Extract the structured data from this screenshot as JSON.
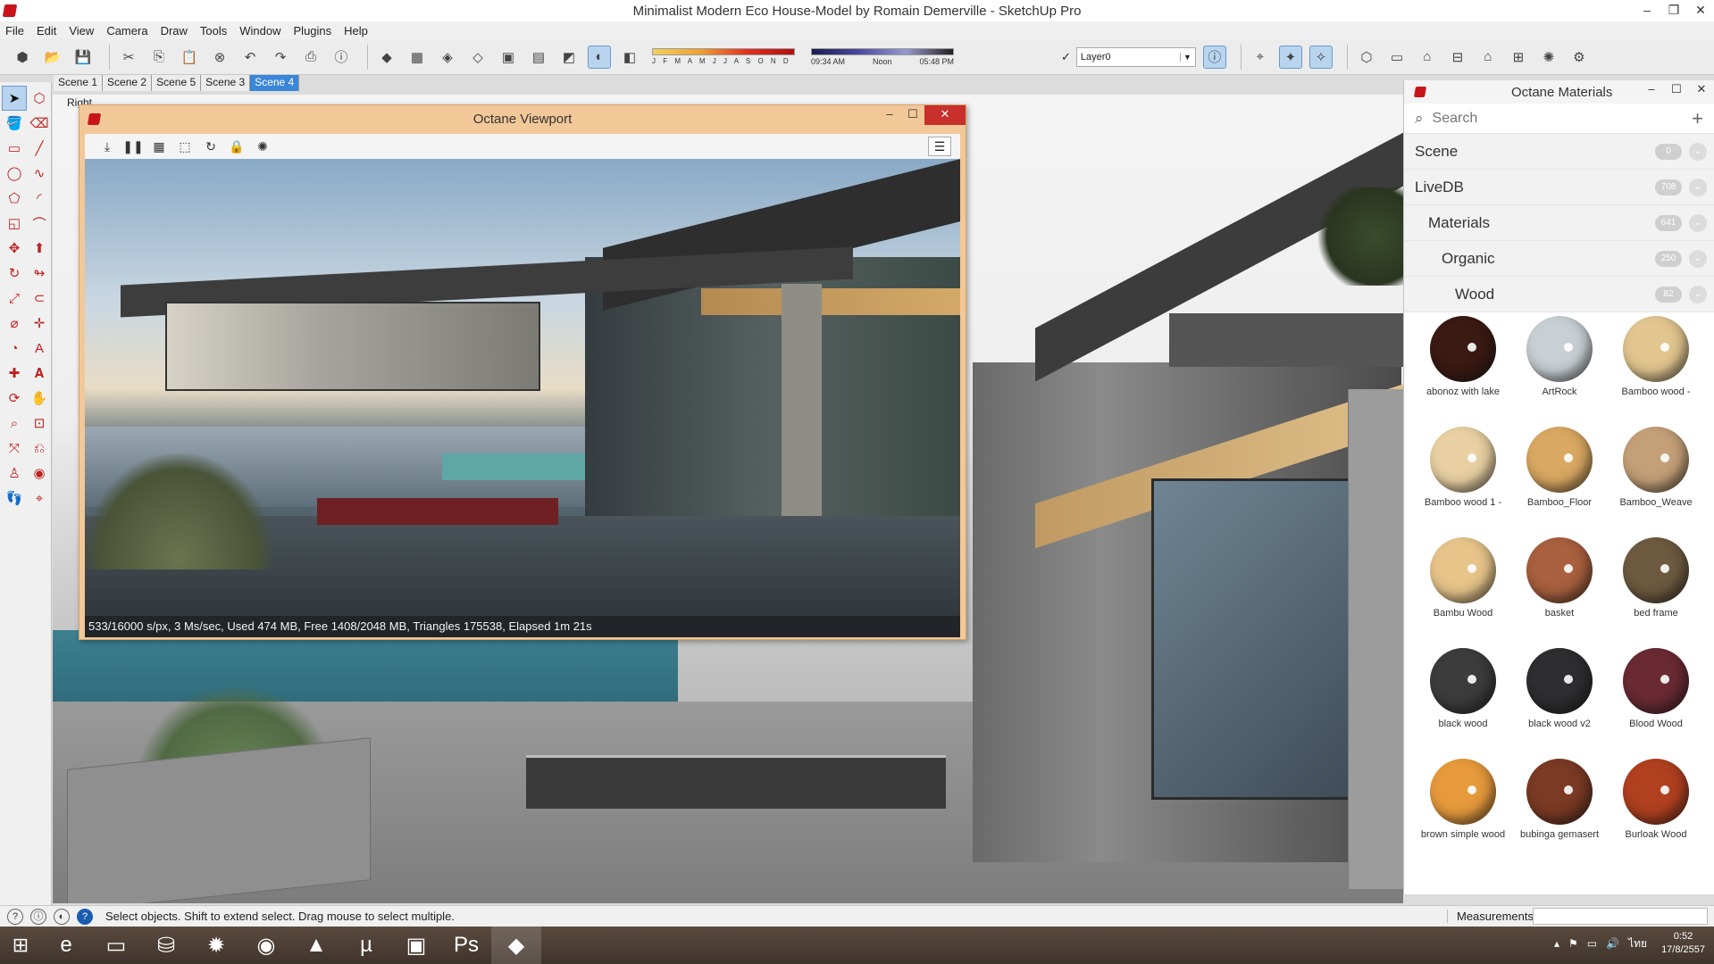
{
  "window": {
    "title": "Minimalist Modern Eco House-Model by Romain Demerville - SketchUp Pro",
    "controls": {
      "minimize": "–",
      "restore": "❐",
      "close": "✕"
    }
  },
  "menu": [
    "File",
    "Edit",
    "View",
    "Camera",
    "Draw",
    "Tools",
    "Window",
    "Plugins",
    "Help"
  ],
  "toolbar": {
    "shadow_months": "J F M A M J J A S O N D",
    "time_start": "09:34 AM",
    "time_mid": "Noon",
    "time_end": "05:48 PM",
    "layer_check": "✓",
    "layer": "Layer0",
    "layer_arrow": "▼"
  },
  "scene_tabs": [
    "Scene 1",
    "Scene 2",
    "Scene 5",
    "Scene 3",
    "Scene 4"
  ],
  "active_scene": "Scene 4",
  "viewport": {
    "view_label": "Right"
  },
  "octane_viewport": {
    "title": "Octane Viewport",
    "controls": {
      "minimize": "–",
      "maximize": "☐",
      "close": "✕"
    },
    "tools": [
      "⤓",
      "❚❚",
      "▦",
      "⬚",
      "↻",
      "🔒",
      "✺"
    ],
    "menu_icon": "☰",
    "status": "533/16000 s/px, 3 Ms/sec, Used 474 MB, Free 1408/2048 MB, Triangles 175538, Elapsed 1m 21s"
  },
  "materials_panel": {
    "title": "Octane Materials",
    "controls": {
      "minimize": "–",
      "maximize": "☐",
      "close": "✕"
    },
    "search_placeholder": "Search",
    "add_icon": "+",
    "search_icon": "⌕",
    "chevron": "⌄",
    "tree": [
      {
        "label": "Scene",
        "count": "0"
      },
      {
        "label": "LiveDB",
        "count": "708"
      },
      {
        "label": "Materials",
        "count": "641"
      },
      {
        "label": "Organic",
        "count": "250"
      },
      {
        "label": "Wood",
        "count": "82"
      }
    ],
    "materials": [
      {
        "name": "abonoz with lake",
        "color": "#3a1a12"
      },
      {
        "name": "ArtRock",
        "color": "#c8d0d4"
      },
      {
        "name": "Bamboo wood -",
        "color": "#e2c690"
      },
      {
        "name": "Bamboo wood 1 -",
        "color": "#e8d0a2"
      },
      {
        "name": "Bamboo_Floor",
        "color": "#d9a862"
      },
      {
        "name": "Bamboo_Weave",
        "color": "#c4a078"
      },
      {
        "name": "Bambu Wood",
        "color": "#e6c48a"
      },
      {
        "name": "basket",
        "color": "#a8603e"
      },
      {
        "name": "bed frame",
        "color": "#6e5a40"
      },
      {
        "name": "black wood",
        "color": "#3c3c3c"
      },
      {
        "name": "black wood v2",
        "color": "#2e2e30"
      },
      {
        "name": "Blood Wood",
        "color": "#6a2a34"
      },
      {
        "name": "brown simple wood",
        "color": "#e79a3c"
      },
      {
        "name": "bubinga gemasert",
        "color": "#7a3a24"
      },
      {
        "name": "Burloak Wood",
        "color": "#b04020"
      }
    ]
  },
  "statusbar": {
    "icons": [
      "?",
      "ⓘ",
      "◐"
    ],
    "message": "Select objects. Shift to extend select. Drag mouse to select multiple.",
    "measurements_label": "Measurements"
  },
  "taskbar": {
    "apps": [
      "⊞",
      "e",
      "▭",
      "⛁",
      "✹",
      "◉",
      "▲",
      "µ",
      "▣",
      "Ps",
      "◆"
    ],
    "tray_icons": [
      "▴",
      "⚑",
      "▭",
      "🔊",
      "ไทย"
    ],
    "time": "0:52",
    "date": "17/8/2557"
  }
}
